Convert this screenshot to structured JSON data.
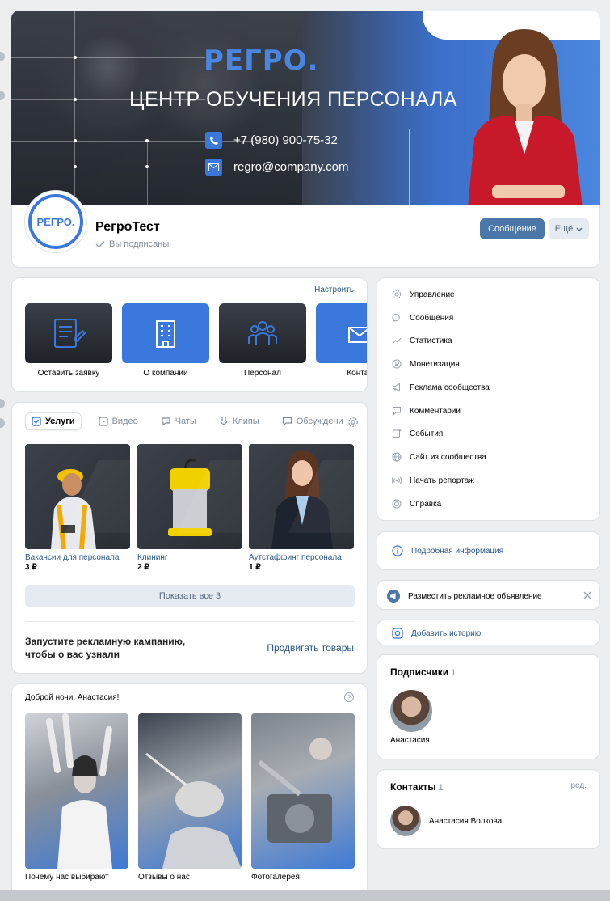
{
  "cover": {
    "logo": "РЕГРО.",
    "title": "ЦЕНТР ОБУЧЕНИЯ ПЕРСОНАЛА",
    "phone": "+7 (980) 900-75-32",
    "email": "regro@company.com"
  },
  "profile": {
    "avatar_text": "РЕГРО.",
    "name": "РегроТест",
    "status": "Вы подписаны",
    "message_button": "Сообщение",
    "more_button": "Ещё"
  },
  "links": {
    "setup": "Настроить",
    "tiles": [
      {
        "label": "Оставить заявку",
        "icon": "form-icon"
      },
      {
        "label": "О компании",
        "icon": "building-icon"
      },
      {
        "label": "Персонал",
        "icon": "people-icon"
      },
      {
        "label": "Контак",
        "icon": "mail-icon"
      }
    ]
  },
  "services": {
    "tabs": [
      {
        "label": "Услуги",
        "icon": "check-icon"
      },
      {
        "label": "Видео",
        "icon": "play-icon"
      },
      {
        "label": "Чаты",
        "icon": "chat-icon"
      },
      {
        "label": "Клипы",
        "icon": "clips-icon"
      },
      {
        "label": "Обсуждени",
        "icon": "discussion-icon"
      }
    ],
    "products": [
      {
        "name": "Вакансии для персонала",
        "price": "3 ₽"
      },
      {
        "name": "Клининг",
        "price": "2 ₽"
      },
      {
        "name": "Аутстаффинг персонала",
        "price": "1 ₽"
      }
    ],
    "show_all": "Показать все 3",
    "promo_text": "Запустите рекламную кампанию, чтобы о вас узнали",
    "promo_link": "Продвигать товары"
  },
  "stories": {
    "greeting": "Доброй ночи, Анастасия!",
    "help": "?",
    "items": [
      {
        "label": "Почему нас выбирают"
      },
      {
        "label": "Отзывы о нас"
      },
      {
        "label": "Фотогалерея"
      }
    ]
  },
  "menu": {
    "items": [
      {
        "label": "Управление",
        "icon": "gear-icon"
      },
      {
        "label": "Сообщения",
        "icon": "message-icon"
      },
      {
        "label": "Статистика",
        "icon": "stats-icon"
      },
      {
        "label": "Монетизация",
        "icon": "ruble-icon"
      },
      {
        "label": "Реклама сообщества",
        "icon": "megaphone-icon"
      },
      {
        "label": "Комментарии",
        "icon": "comment-icon"
      },
      {
        "label": "События",
        "icon": "event-icon"
      },
      {
        "label": "Сайт из сообщества",
        "icon": "globe-icon"
      },
      {
        "label": "Начать репортаж",
        "icon": "broadcast-icon"
      },
      {
        "label": "Справка",
        "icon": "help-circle-icon"
      }
    ]
  },
  "info": {
    "label": "Подробная информация"
  },
  "ad": {
    "label": "Разместить рекламное объявление"
  },
  "story_add": {
    "label": "Добавить историю"
  },
  "subscribers": {
    "title": "Подписчики",
    "count": "1",
    "name": "Анастасия"
  },
  "contacts": {
    "title": "Контакты",
    "count": "1",
    "edit": "ред.",
    "name": "Анастасия Волкова"
  },
  "colors": {
    "accent": "#3b78dc",
    "link": "#2a5885",
    "button": "#4a76a8",
    "background": "#edeef0"
  }
}
